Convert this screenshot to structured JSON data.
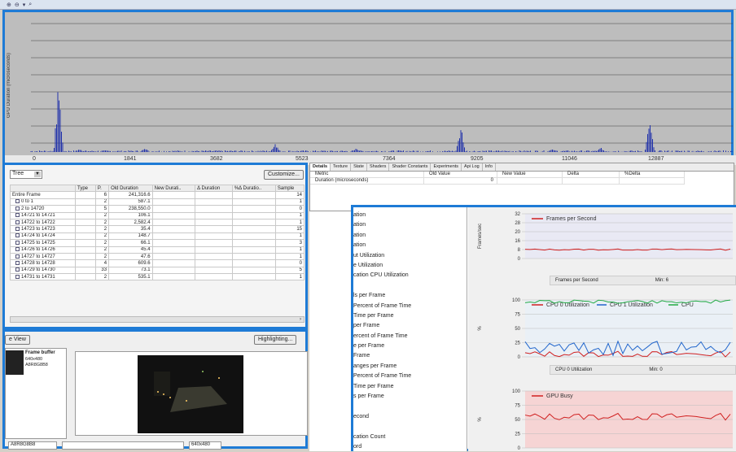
{
  "toolbar": {
    "icons": [
      "zoom-in-icon",
      "zoom-out-icon",
      "arrow-down-icon",
      "search-icon"
    ]
  },
  "timeline": {
    "ylabel": "GPU Duration (microseconds)",
    "ticks": [
      "0",
      "1841",
      "3682",
      "5523",
      "7364",
      "9205",
      "11046",
      "12887"
    ],
    "spikes_color": "#2233aa"
  },
  "left": {
    "combo_value": "Tree",
    "customize_label": "Customize...",
    "columns": [
      "",
      "Type",
      "P.",
      "Old Duration",
      "New Durati..",
      "Δ Duration",
      "%Δ Duratio..",
      "Sample"
    ],
    "rows": [
      {
        "name": "Entire Frame",
        "type": "",
        "p": "6",
        "old": "241,316.6",
        "sample": "14",
        "indent": 0
      },
      {
        "name": "0 to 1",
        "type": "",
        "p": "2",
        "old": "587.1",
        "sample": "1",
        "indent": 1
      },
      {
        "name": "2 to 14720",
        "type": "",
        "p": "5",
        "old": "238,550.0",
        "sample": "0",
        "indent": 1
      },
      {
        "name": "14721 to 14721",
        "type": "",
        "p": "2",
        "old": "106.1",
        "sample": "1",
        "indent": 1
      },
      {
        "name": "14722 to 14722",
        "type": "",
        "p": "2",
        "old": "2,582.4",
        "sample": "1",
        "indent": 1
      },
      {
        "name": "14723 to 14723",
        "type": "",
        "p": "2",
        "old": "35.4",
        "sample": "15",
        "indent": 1
      },
      {
        "name": "14724 to 14724",
        "type": "",
        "p": "2",
        "old": "148.7",
        "sample": "1",
        "indent": 1
      },
      {
        "name": "14725 to 14725",
        "type": "",
        "p": "2",
        "old": "66.1",
        "sample": "3",
        "indent": 1
      },
      {
        "name": "14726 to 14726",
        "type": "",
        "p": "2",
        "old": "45.4",
        "sample": "1",
        "indent": 1
      },
      {
        "name": "14727 to 14727",
        "type": "",
        "p": "2",
        "old": "47.6",
        "sample": "1",
        "indent": 1
      },
      {
        "name": "14728 to 14728",
        "type": "",
        "p": "4",
        "old": "609.6",
        "sample": "0",
        "indent": 1
      },
      {
        "name": "14729 to 14730",
        "type": "",
        "p": "33",
        "old": "73.1",
        "sample": "5",
        "indent": 1
      },
      {
        "name": "14731 to 14731",
        "type": "",
        "p": "2",
        "old": "535.1",
        "sample": "1",
        "indent": 1
      }
    ]
  },
  "preview": {
    "view_label": "e View",
    "highlighting_label": "Highlighting...",
    "thumb_title": "Frame buffer",
    "thumb_sub1": "640x480",
    "thumb_sub2": "A8R8G8B8",
    "status_left": "A8R8G8B8",
    "status_right": "640x480"
  },
  "details": {
    "tabs": [
      "Details",
      "Texture",
      "State",
      "Shaders",
      "Shader Constants",
      "Experiments",
      "Api Log",
      "Info"
    ],
    "headers": [
      "Metric",
      "Old Value",
      "New Value",
      "Delta",
      "%Delta"
    ],
    "row": [
      "Duration (microseconds)",
      "0",
      "",
      "",
      ""
    ]
  },
  "metrics": [
    "ation",
    "ation",
    "ation",
    "ation",
    "ut Utilization",
    "e Utilization",
    "cation CPU Utilization",
    "",
    "ls per Frame",
    "Percent of Frame Time",
    "Time per Frame",
    "per Frame",
    "ercent of Frame Time",
    "e per Frame",
    "Frame",
    "anges per Frame",
    "Percent of Frame Time",
    "Time per Frame",
    "s per Frame",
    "",
    "econd",
    "",
    "cation Count",
    "ord"
  ],
  "charts": [
    {
      "name": "fps-chart",
      "ylabel": "Frames/sec",
      "title": "Frames per Second",
      "yticks": [
        "32",
        "28",
        "20",
        "16",
        "8",
        "0"
      ],
      "legend_text": "Frames per Second",
      "legend_min": "Min: 6",
      "series_colors": [
        "#d02020"
      ]
    },
    {
      "name": "cpu-chart",
      "ylabel": "%",
      "title": "CPU 0 Utilization",
      "title2": "CPU 1 Utilization",
      "title3": "CPU",
      "yticks": [
        "100",
        "75",
        "50",
        "25",
        "0"
      ],
      "legend_text": "CPU 0 Utilization",
      "legend_min": "Min: 0",
      "series_colors": [
        "#d02020",
        "#2266cc",
        "#22aa44"
      ]
    },
    {
      "name": "gpu-chart",
      "ylabel": "%",
      "title": "GPU Busy",
      "yticks": [
        "100",
        "75",
        "50",
        "25",
        "0"
      ],
      "series_colors": [
        "#d02020"
      ]
    }
  ],
  "colors": {
    "frame_border": "#1e7bd6"
  }
}
